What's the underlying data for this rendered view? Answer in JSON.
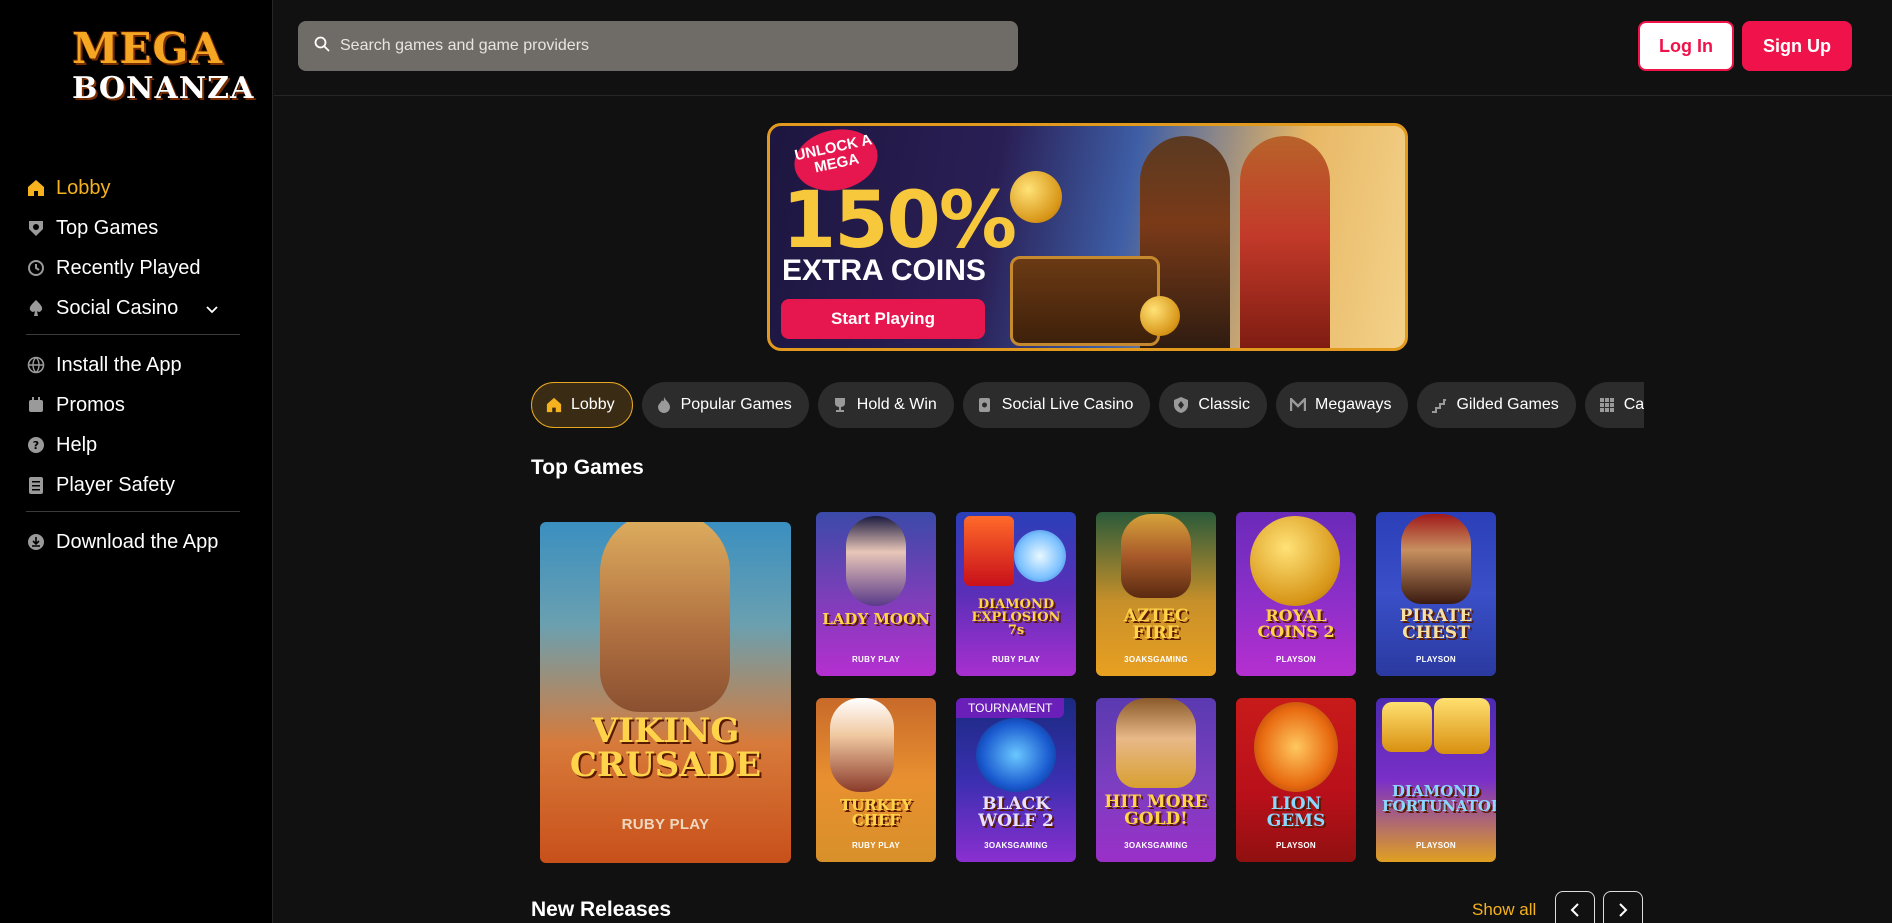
{
  "brand": {
    "logo_line1": "MEGA",
    "logo_line2": "BONANZA"
  },
  "sidebar": {
    "items": [
      {
        "label": "Lobby",
        "icon": "home-icon"
      },
      {
        "label": "Top Games",
        "icon": "shield-star-icon"
      },
      {
        "label": "Recently Played",
        "icon": "history-icon"
      },
      {
        "label": "Social Casino",
        "icon": "spade-icon"
      },
      {
        "label": "Install the App",
        "icon": "globe-icon"
      },
      {
        "label": "Promos",
        "icon": "calendar-icon"
      },
      {
        "label": "Help",
        "icon": "help-icon"
      },
      {
        "label": "Player Safety",
        "icon": "clipboard-icon"
      },
      {
        "label": "Download the App",
        "icon": "download-icon"
      }
    ]
  },
  "header": {
    "search_placeholder": "Search games and game providers",
    "login_label": "Log In",
    "signup_label": "Sign Up"
  },
  "banner": {
    "badge": "UNLOCK A MEGA",
    "headline": "150%",
    "subheadline": "EXTRA COINS",
    "cta": "Start Playing"
  },
  "tabs": [
    {
      "label": "Lobby",
      "icon": "home-icon"
    },
    {
      "label": "Popular Games",
      "icon": "flame-icon"
    },
    {
      "label": "Hold & Win",
      "icon": "trophy-icon"
    },
    {
      "label": "Social Live Casino",
      "icon": "card-icon"
    },
    {
      "label": "Classic",
      "icon": "badge-icon"
    },
    {
      "label": "Megaways",
      "icon": "m-icon"
    },
    {
      "label": "Gilded Games",
      "icon": "stairs-icon"
    },
    {
      "label": "Cascading",
      "icon": "grid-icon"
    }
  ],
  "top_games": {
    "title": "Top Games",
    "featured": {
      "name": "VIKING CRUSADE",
      "provider": "RUBY PLAY"
    },
    "games": [
      {
        "name": "LADY MOON",
        "provider": "RUBY PLAY"
      },
      {
        "name": "DIAMOND EXPLOSION 7s",
        "provider": "RUBY PLAY"
      },
      {
        "name": "AZTEC FIRE",
        "provider": "3OAKSGAMING"
      },
      {
        "name": "ROYAL COINS 2",
        "provider": "PLAYSON"
      },
      {
        "name": "PIRATE CHEST",
        "provider": "PLAYSON"
      },
      {
        "name": "TURKEY CHEF",
        "provider": "RUBY PLAY"
      },
      {
        "name": "BLACK WOLF 2",
        "provider": "3OAKSGAMING",
        "badge": "TOURNAMENT"
      },
      {
        "name": "HIT MORE GOLD!",
        "provider": "3OAKSGAMING"
      },
      {
        "name": "LION GEMS",
        "provider": "PLAYSON"
      },
      {
        "name": "DIAMOND FORTUNATOR",
        "provider": "PLAYSON"
      }
    ]
  },
  "new_releases": {
    "title": "New Releases",
    "show_all": "Show all"
  },
  "colors": {
    "accent": "#f5b21e",
    "brand_red": "#f0124a",
    "bg": "#111111"
  }
}
